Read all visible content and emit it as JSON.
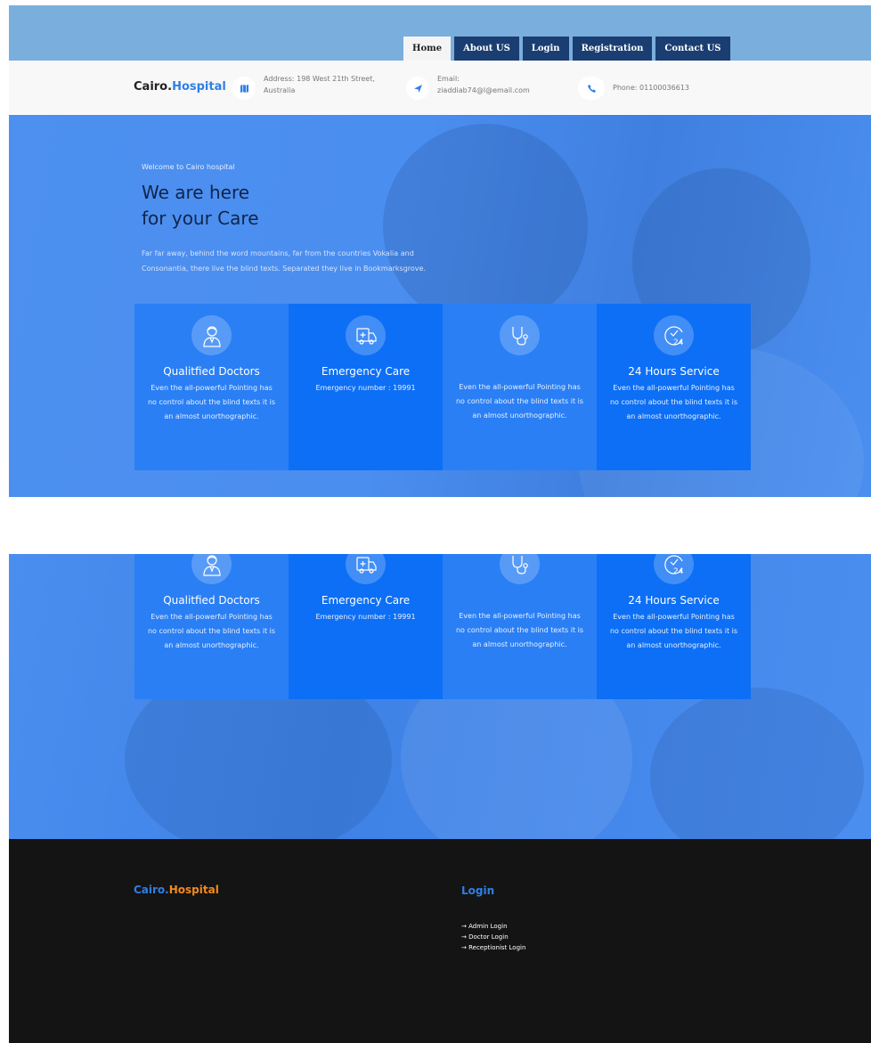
{
  "nav": {
    "items": [
      {
        "label": "Home",
        "active": true
      },
      {
        "label": "About US"
      },
      {
        "label": "Login"
      },
      {
        "label": "Registration"
      },
      {
        "label": "Contact US"
      }
    ]
  },
  "brand": {
    "part1": "Cairo.",
    "part2": "Hospital"
  },
  "info": {
    "address": "Address: 198 West 21th Street, Australia",
    "email_label": "Email:",
    "email": "ziaddiab74@l@email.com",
    "phone": "Phone: 01100036613"
  },
  "hero": {
    "welcome": "Welcome to Cairo hospital",
    "title_line1": "We are here",
    "title_line2": "for your Care",
    "lead": "Far far away, behind the word mountains, far from the countries Vokalia and Consonantia, there live the blind texts. Separated they live in Bookmarksgrove."
  },
  "features": [
    {
      "icon": "doctor-icon",
      "title": "Qualitfied Doctors",
      "text": "Even the all-powerful Pointing has no control about the blind texts it is an almost unorthographic."
    },
    {
      "icon": "ambulance-icon",
      "title": "Emergency Care",
      "text": "Emergency number : 19991"
    },
    {
      "icon": "stethoscope-icon",
      "title": "",
      "text": "Even the all-powerful Pointing has no control about the blind texts it is an almost unorthographic."
    },
    {
      "icon": "clock-24-icon",
      "title": "24 Hours Service",
      "text": "Even the all-powerful Pointing has no control about the blind texts it is an almost unorthographic."
    }
  ],
  "footer": {
    "brand_part1": "Cairo.",
    "brand_part2": "Hospital",
    "login_title": "Login",
    "links": [
      "→ Admin Login",
      "→ Doctor Login",
      "→ Receptionist Login"
    ]
  },
  "colors": {
    "accent": "#2f7fe6",
    "nav_dark": "#1a3e72",
    "card": "#2a7ff5",
    "card_alt": "#0d6ff5",
    "footer_bg": "#141414",
    "brand_orange": "#f28a1c"
  }
}
